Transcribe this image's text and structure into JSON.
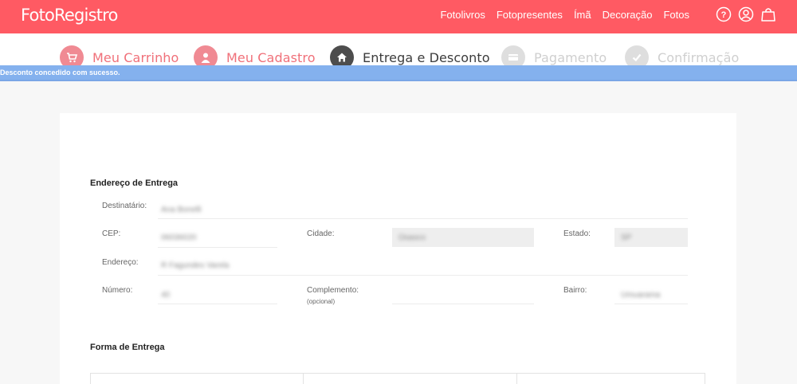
{
  "header": {
    "logo": "FotoRegistro",
    "nav": [
      "Fotolivros",
      "Fotopresentes",
      "Ímã",
      "Decoração",
      "Fotos"
    ],
    "icons": [
      "help-icon",
      "user-icon",
      "shopping-bag-icon"
    ]
  },
  "steps": [
    {
      "label": "Meu Carrinho",
      "state": "done",
      "icon": "cart-icon"
    },
    {
      "label": "Meu Cadastro",
      "state": "done",
      "icon": "user-icon"
    },
    {
      "label": "Entrega e Desconto",
      "state": "current",
      "icon": "home-icon"
    },
    {
      "label": "Pagamento",
      "state": "todo",
      "icon": "card-icon"
    },
    {
      "label": "Confirmação",
      "state": "todo",
      "icon": "check-icon"
    }
  ],
  "alert": {
    "message": "Desconto concedido com sucesso."
  },
  "address": {
    "title": "Endereço de Entrega",
    "recipient_label": "Destinatário:",
    "recipient_value": "Ana Bonelli",
    "cep_label": "CEP:",
    "cep_value": "06036020",
    "city_label": "Cidade:",
    "city_value": "Osasco",
    "state_label": "Estado:",
    "state_value": "SP",
    "street_label": "Endereço:",
    "street_value": "R Fagundes Varela",
    "number_label": "Número:",
    "number_value": "40",
    "complement_label": "Complemento:",
    "complement_hint": "(opcional)",
    "complement_value": "",
    "district_label": "Bairro:",
    "district_value": "Umuarama"
  },
  "shipping": {
    "title": "Forma de Entrega"
  }
}
